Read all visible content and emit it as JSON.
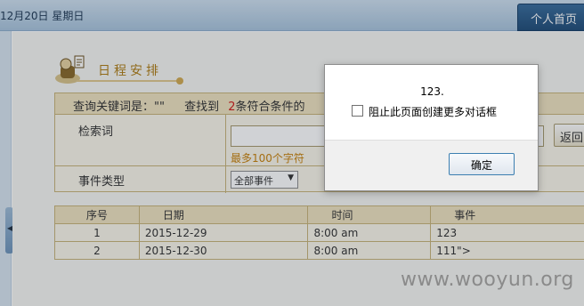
{
  "header": {
    "date": "12月20日 星期日",
    "home_tab": "个人首页"
  },
  "page": {
    "title": "日程安排",
    "summary_prefix": "查询关键词是：\"\"",
    "summary_found": "查找到",
    "summary_count": "2",
    "summary_suffix": "条符合条件的"
  },
  "search_form": {
    "keyword_label": "检索词",
    "keyword_value": "",
    "keyword_hint": "最多100个字符",
    "back_label": "返回",
    "event_type_label": "事件类型",
    "event_type_value": "全部事件"
  },
  "results": {
    "columns": [
      "序号",
      "日期",
      "时间",
      "事件"
    ],
    "rows": [
      [
        "1",
        "2015-12-29",
        "8:00 am",
        "123"
      ],
      [
        "2",
        "2015-12-30",
        "8:00 am",
        "111\">"
      ]
    ]
  },
  "dialog": {
    "message": "123.",
    "checkbox_label": "阻止此页面创建更多对话框",
    "ok_label": "确定"
  },
  "watermark": "www.wooyun.org"
}
